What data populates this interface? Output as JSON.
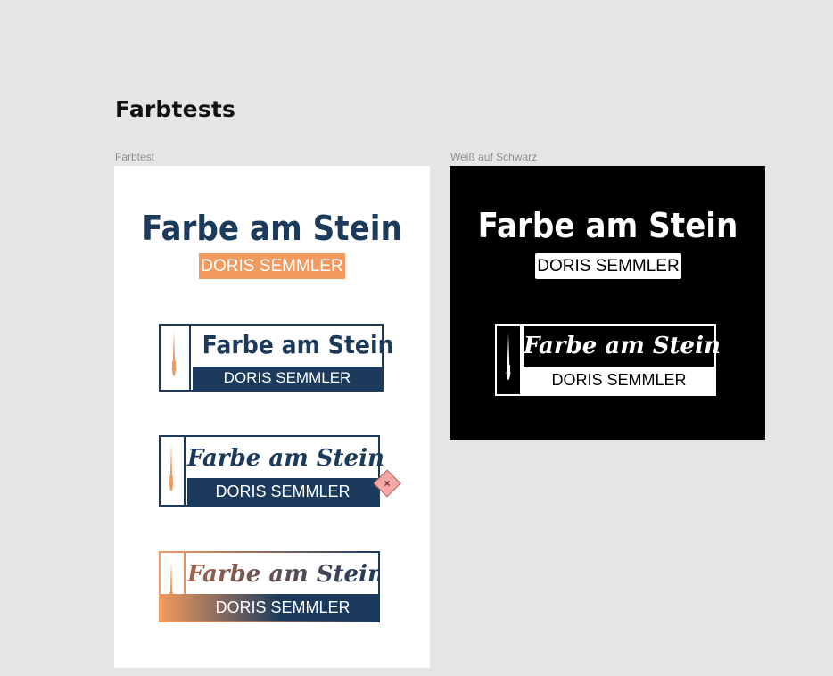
{
  "page": {
    "title": "Farbtests"
  },
  "frames": {
    "left": {
      "label": "Farbtest"
    },
    "right": {
      "label": "Weiß auf Schwarz"
    }
  },
  "logo": {
    "brand": "Farbe am Stein",
    "person": "DORIS SEMMLER"
  },
  "icons": {
    "brush": "paintbrush-icon",
    "badge": "close-icon"
  },
  "badge": {
    "symbol": "×"
  },
  "colors": {
    "navy": "#1b3a5c",
    "orange": "#f29a60",
    "black": "#000000",
    "white": "#ffffff",
    "gradient_start": "#f29a60",
    "gradient_end": "#1b3a5c"
  }
}
